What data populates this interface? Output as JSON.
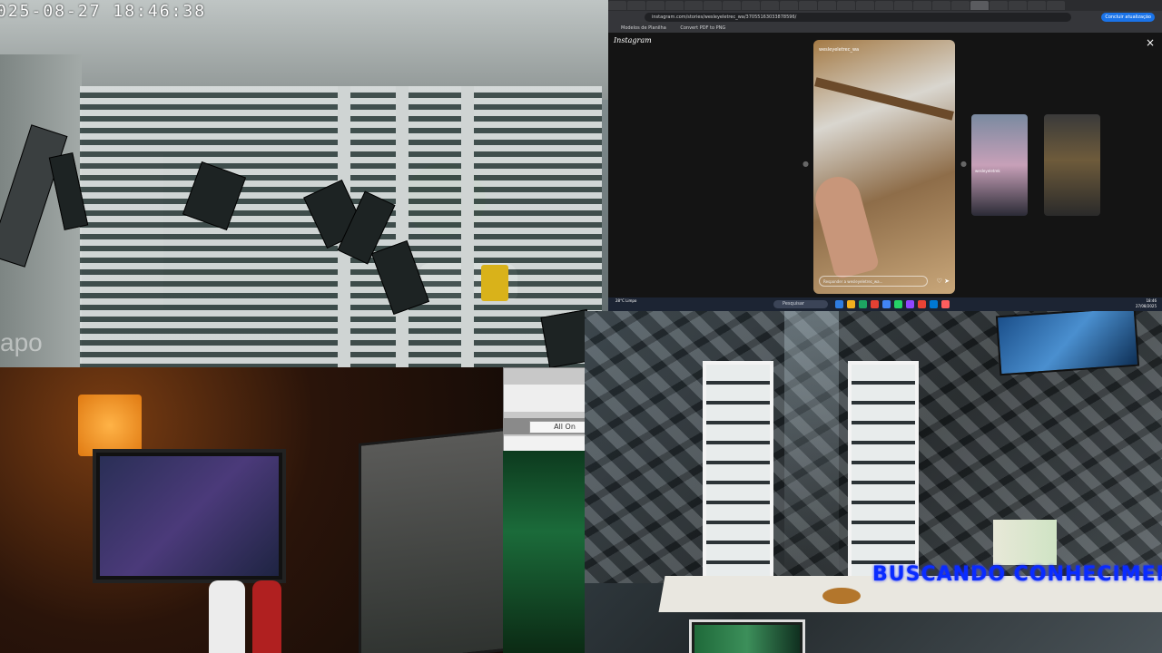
{
  "camera_top_left": {
    "timestamp": "025-08-27  18:46:38",
    "watermark": "apo"
  },
  "browser": {
    "url": "instagram.com/stories/wesleyeletrec_wa/37055163033878596/",
    "update_button": "Concluir atualização",
    "bookmarks": [
      "Modelos de Planilha",
      "Convert PDF to PNG"
    ],
    "instagram_logo": "Instagram",
    "close_icon": "×",
    "story": {
      "username": "wesleyeletrec_wa",
      "reply_placeholder": "Responder a wesleyeletrec_wa...",
      "action_icons": "♡ ➤"
    },
    "thumbnails": [
      {
        "name": "wesleyeletrek"
      },
      {
        "name": ""
      }
    ],
    "taskbar": {
      "weather": "28°C Limpo",
      "search_placeholder": "Pesquisar",
      "clock_time": "18:46",
      "clock_date": "27/08/2025"
    }
  },
  "popup": {
    "button_label": "All On"
  },
  "camera_bottom_right": {
    "banner": "BUSCANDO CONHECIMENTO"
  }
}
